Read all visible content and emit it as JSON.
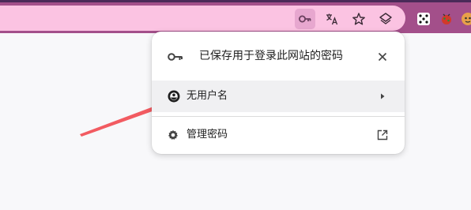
{
  "toolbar": {
    "icons": [
      "key-icon",
      "translate-icon",
      "star-icon",
      "layers-icon"
    ],
    "extensions": [
      "dice-extension-icon",
      "bug-extension-icon",
      "character-extension-icon"
    ],
    "colors": {
      "frame": "#a34f8a",
      "omnibox": "#fbc3e2",
      "active_icon_bg": "#e7a7cf"
    }
  },
  "password_bubble": {
    "title": "已保存用于登录此网站的密码",
    "entries": [
      {
        "username": "无用户名"
      }
    ],
    "manage_label": "管理密码"
  },
  "annotation": {
    "arrow_color": "#f25b61"
  }
}
